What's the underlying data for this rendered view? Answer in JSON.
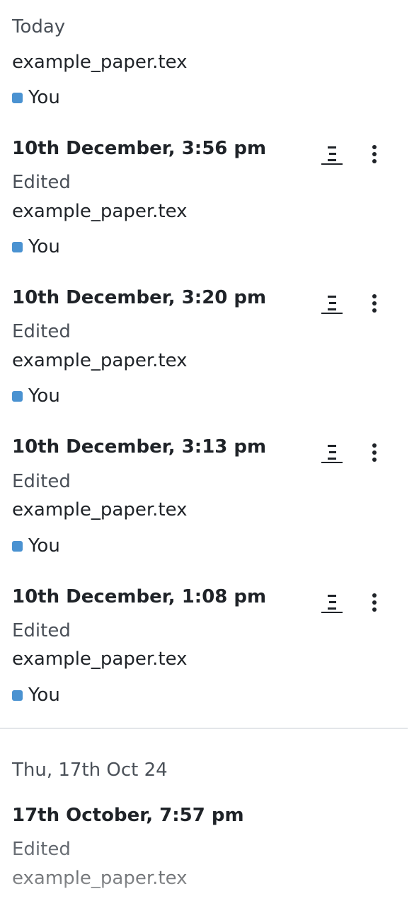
{
  "history": {
    "groups": [
      {
        "header": "Today",
        "top_entry": {
          "file": "example_paper.tex",
          "user": "You"
        },
        "entries": [
          {
            "date": "10th December, 3:56 pm",
            "action": "Edited",
            "file": "example_paper.tex",
            "user": "You"
          },
          {
            "date": "10th December, 3:20 pm",
            "action": "Edited",
            "file": "example_paper.tex",
            "user": "You"
          },
          {
            "date": "10th December, 3:13 pm",
            "action": "Edited",
            "file": "example_paper.tex",
            "user": "You"
          },
          {
            "date": "10th December, 1:08 pm",
            "action": "Edited",
            "file": "example_paper.tex",
            "user": "You"
          }
        ]
      },
      {
        "header": "Thu, 17th Oct 24",
        "entries": [
          {
            "date": "17th October, 7:57 pm",
            "action": "Edited",
            "file": "example_paper.tex"
          }
        ]
      }
    ]
  },
  "icons": {
    "compare": "compare-icon",
    "more": "more-vertical-icon"
  },
  "colors": {
    "user_swatch": "#4a92d1",
    "divider": "#e3e6e9",
    "muted_text": "#4a5058"
  }
}
